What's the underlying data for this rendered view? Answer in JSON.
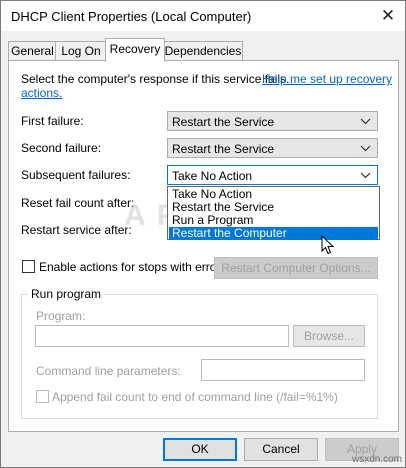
{
  "window": {
    "title": "DHCP Client Properties (Local Computer)",
    "close_glyph": "✕"
  },
  "tabs": [
    {
      "label": "General"
    },
    {
      "label": "Log On"
    },
    {
      "label": "Recovery"
    },
    {
      "label": "Dependencies"
    }
  ],
  "recovery": {
    "intro": "Select the computer's response if this service fails.",
    "help_link": "Help me set up recovery actions.",
    "help_link_part1": "Help me set up recovery",
    "help_link_part2": "actions.",
    "first_failure": {
      "label": "First failure:",
      "value": "Restart the Service"
    },
    "second_failure": {
      "label": "Second failure:",
      "value": "Restart the Service"
    },
    "subsequent_failures": {
      "label": "Subsequent failures:",
      "value": "Take No Action",
      "options": [
        "Take No Action",
        "Restart the Service",
        "Run a Program",
        "Restart the Computer"
      ],
      "highlighted": "Restart the Computer"
    },
    "reset_fail_count_label": "Reset fail count after:",
    "restart_service_label": "Restart service after:",
    "enable_actions_label": "Enable actions for stops with errors.",
    "restart_options_button": "Restart Computer Options..."
  },
  "run_program": {
    "group_label": "Run program",
    "program_label": "Program:",
    "browse_button": "Browse...",
    "cmd_params_label": "Command line parameters:",
    "append_label": "Append fail count to end of command line (/fail=%1%)"
  },
  "buttons": {
    "ok": "OK",
    "cancel": "Cancel",
    "apply": "Apply"
  },
  "watermark": "APPUALS",
  "footer": "wsxdn.com"
}
